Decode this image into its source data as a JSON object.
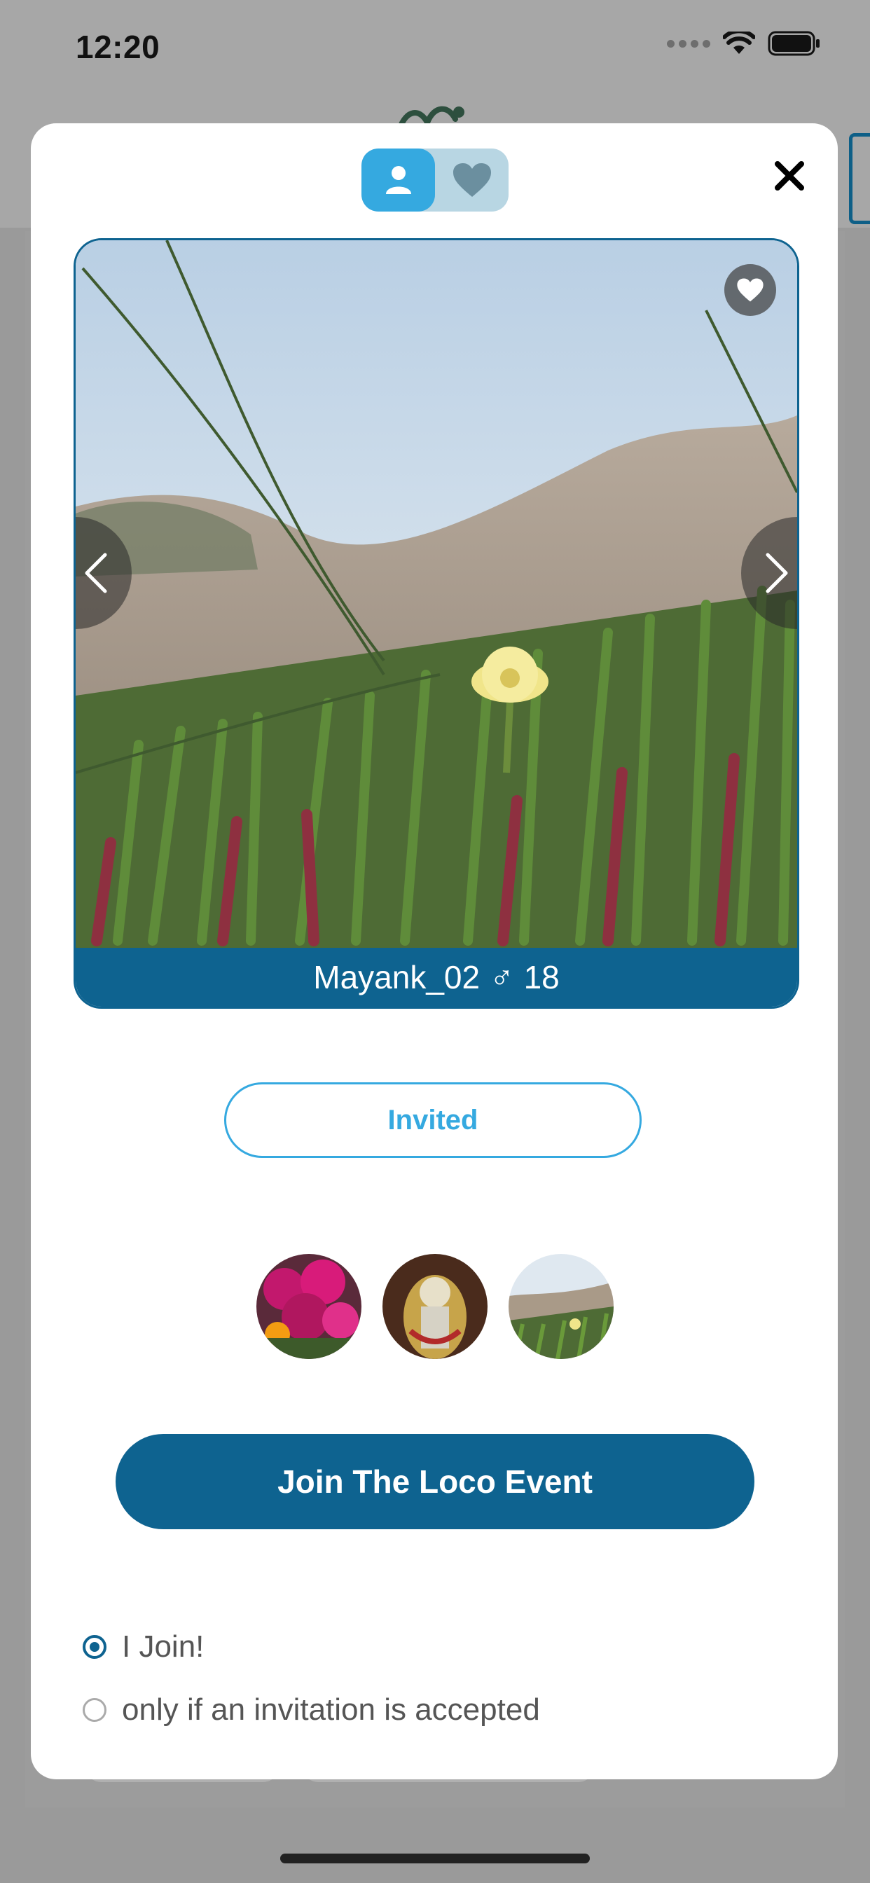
{
  "status_bar": {
    "time": "12:20"
  },
  "modal": {
    "segments": [
      {
        "icon": "person-icon",
        "active": true
      },
      {
        "icon": "heart-icon",
        "active": false
      }
    ],
    "close_icon": "close-icon",
    "profile": {
      "name": "Mayank_02",
      "gender_symbol": "♂",
      "age": "18"
    },
    "invited_label": "Invited",
    "join_label": "Join The Loco Event",
    "options": [
      {
        "label": "I Join!",
        "selected": true
      },
      {
        "label": "only if an invitation is accepted",
        "selected": false
      }
    ]
  },
  "colors": {
    "primary": "#0e6390",
    "accent": "#35a9e0"
  }
}
